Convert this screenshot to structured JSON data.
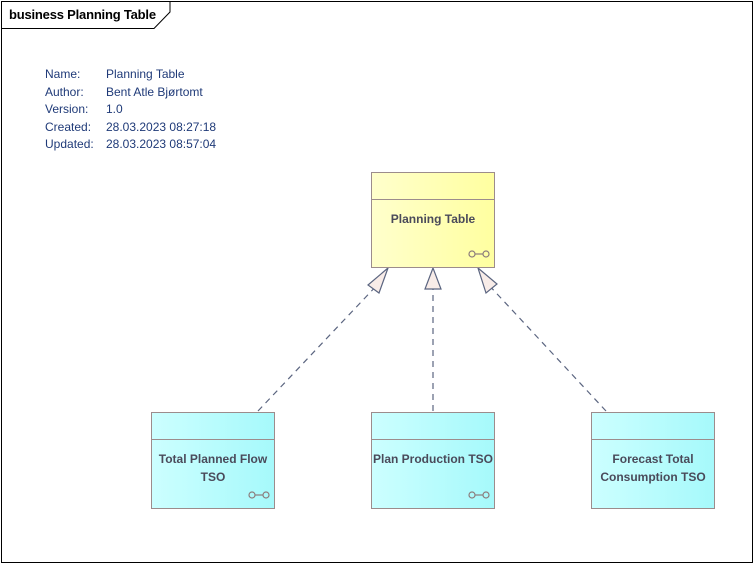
{
  "diagram": {
    "frame_title": "business Planning Table",
    "notes": [
      {
        "key": "Name:",
        "value": "Planning Table"
      },
      {
        "key": "Author:",
        "value": "Bent Atle Bjørtomt"
      },
      {
        "key": "Version:",
        "value": "1.0"
      },
      {
        "key": "Created:",
        "value": "28.03.2023 08:27:18"
      },
      {
        "key": "Updated:",
        "value": "28.03.2023 08:57:04"
      }
    ],
    "elements": {
      "parent": {
        "label": "Planning Table",
        "has_link_icon": true,
        "fill": "#ffffb8"
      },
      "child1": {
        "label_line1": "Total Planned Flow",
        "label_line2": "TSO",
        "has_link_icon": true,
        "fill": "#b8fcff"
      },
      "child2": {
        "label": "Plan Production TSO",
        "has_link_icon": true,
        "fill": "#b8fcff"
      },
      "child3": {
        "label_line1": "Forecast Total",
        "label_line2": "Consumption TSO",
        "has_link_icon": false,
        "fill": "#b8fcff"
      }
    },
    "connectors": [
      {
        "type": "realization",
        "from": "Total Planned Flow TSO",
        "to": "Planning Table"
      },
      {
        "type": "realization",
        "from": "Plan Production TSO",
        "to": "Planning Table"
      },
      {
        "type": "realization",
        "from": "Forecast Total Consumption TSO",
        "to": "Planning Table"
      }
    ],
    "colors": {
      "line": "#5b6580",
      "border": "#9c8c8c",
      "text": "#4a4a5a",
      "notes_text": "#1f3a78"
    }
  }
}
